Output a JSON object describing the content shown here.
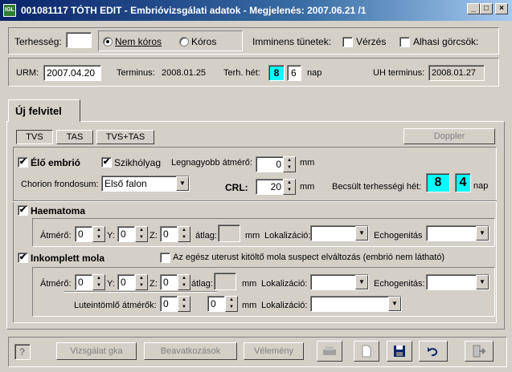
{
  "window": {
    "title": "001081117  TÓTH EDIT - Embrióvizsgálati adatok  - Megjelenés: 2007.06.21 /1",
    "app_icon": "app-logo-icon",
    "controls": {
      "minimize": "_",
      "maximize": "□",
      "close": "×"
    }
  },
  "header": {
    "terhesseg_label": "Terhesség:",
    "terhesseg_value": "",
    "radio_nem_koros": "Nem kóros",
    "radio_koros": "Kóros",
    "selected_radio": "Nem kóros",
    "imminens_label": "Imminens tünetek:",
    "verzes_label": "Vérzés",
    "alhasi_label": "Alhasi görcsök:"
  },
  "dates": {
    "urm_label": "URM:",
    "urm_value": "2007.04.20",
    "terminus_label": "Terminus:",
    "terminus_value": "2008.01.25",
    "terh_het_label": "Terh. hét:",
    "terh_het_weeks": "8",
    "terh_het_days": "6",
    "nap_label": "nap",
    "uh_terminus_label": "UH terminus:",
    "uh_terminus_value": "2008.01.27"
  },
  "main_tab": "Új felvitel",
  "subtabs": {
    "tvs": "TVS",
    "tas": "TAS",
    "tvs_tas": "TVS+TAS",
    "selected": "TVS"
  },
  "doppler_button": "Doppler",
  "elo_embrio": {
    "label": "Élő embrió",
    "checked": true,
    "szikholyag_label": "Szikhólyag",
    "szikholyag_checked": true,
    "legnagyobb_label": "Legnagyobb átmérő:",
    "legnagyobb_value": "0",
    "mm": "mm",
    "chorion_label": "Chorion frondosum:",
    "chorion_value": "Első falon",
    "crl_label": "CRL:",
    "crl_value": "20",
    "becsult_label": "Becsült terhességi hét:",
    "becsult_weeks": "8",
    "becsult_days": "4",
    "nap": "nap"
  },
  "haematoma": {
    "label": "Haematoma",
    "checked": true,
    "atmero_label": "Átmérő:",
    "x": "0",
    "y_label": "Y:",
    "y": "0",
    "z_label": "Z:",
    "z": "0",
    "atlag_label": "átlag:",
    "atlag_value": "",
    "mm": "mm",
    "lokalizacio_label": "Lokalizáció:",
    "lokalizacio_value": "",
    "echogenitas_label": "Echogenitás",
    "echogenitas_value": ""
  },
  "inkomplett": {
    "label": "Inkomplett mola",
    "checked": true,
    "egesz_label": "Az egész uterust kitöltő mola suspect elváltozás (embrió nem látható)",
    "egesz_checked": false,
    "atmero_label": "Átmérő:",
    "x": "0",
    "y_label": "Y:",
    "y": "0",
    "z_label": "Z:",
    "z": "0",
    "atlag_label": "átlag:",
    "atlag_value": "",
    "mm": "mm",
    "lokalizacio_label": "Lokalizáció:",
    "lokalizacio_value": "",
    "echogenitas_label": "Echogenitás:",
    "echogenitas_value": "",
    "lutein_label": "Luteintömlő átmérők:",
    "lutein_1": "0",
    "lutein_2": "0",
    "lutein_mm": "mm",
    "lutein_lokalizacio_label": "Lokalizáció:",
    "lutein_lokalizacio_value": ""
  },
  "footer": {
    "help": "?",
    "vizsgalat_button": "Vizsgálat gka",
    "beavatkozasok_button": "Beavatkozások",
    "velemeny_button": "Vélemény",
    "icons": [
      "printer-icon",
      "new-page-icon",
      "save-icon",
      "undo-icon",
      "exit-icon"
    ]
  }
}
